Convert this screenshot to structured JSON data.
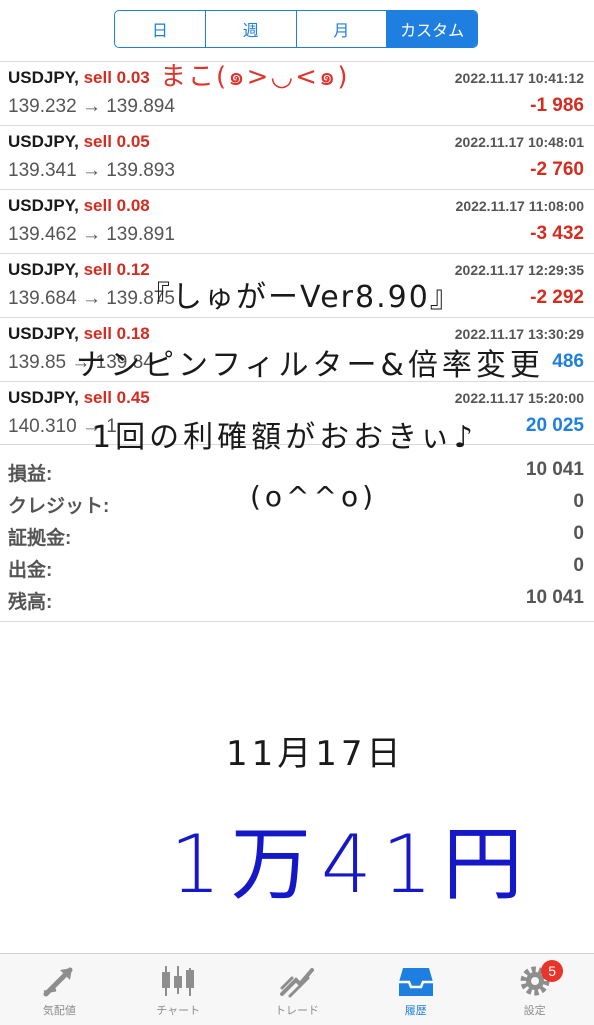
{
  "period_tabs": [
    "日",
    "週",
    "月",
    "カスタム"
  ],
  "period_active": 3,
  "trades": [
    {
      "symbol": "USDJPY",
      "side": "sell 0.03",
      "prices": "139.232 → 139.894",
      "time": "2022.11.17 10:41:12",
      "profit": "-1 986",
      "profit_sign": "neg"
    },
    {
      "symbol": "USDJPY",
      "side": "sell 0.05",
      "prices": "139.341 → 139.893",
      "time": "2022.11.17 10:48:01",
      "profit": "-2 760",
      "profit_sign": "neg"
    },
    {
      "symbol": "USDJPY",
      "side": "sell 0.08",
      "prices": "139.462 → 139.891",
      "time": "2022.11.17 11:08:00",
      "profit": "-3 432",
      "profit_sign": "neg"
    },
    {
      "symbol": "USDJPY",
      "side": "sell 0.12",
      "prices": "139.684 → 139.875",
      "time": "2022.11.17 12:29:35",
      "profit": "-2 292",
      "profit_sign": "neg"
    },
    {
      "symbol": "USDJPY",
      "side": "sell 0.18",
      "prices": "139.85 → 139.84",
      "time": "2022.11.17 13:30:29",
      "profit": "486",
      "profit_sign": "pos"
    },
    {
      "symbol": "USDJPY",
      "side": "sell 0.45",
      "prices": "140.310 → 1",
      "time": "2022.11.17 15:20:00",
      "profit": "20 025",
      "profit_sign": "pos"
    }
  ],
  "summary": [
    {
      "label": "損益:",
      "value": "10 041"
    },
    {
      "label": "クレジット:",
      "value": "0"
    },
    {
      "label": "証拠金:",
      "value": "0"
    },
    {
      "label": "出金:",
      "value": "0"
    },
    {
      "label": "残高:",
      "value": "10 041"
    }
  ],
  "handwriting": {
    "name": "まこ(๑>◡<๑)",
    "line1": "『しゅがーVer8.90』",
    "line2": "ナンピンフィルター&倍率変更",
    "line3": "1回の利確額がおおきぃ♪",
    "line4": "(o^^o)",
    "date": "11月17日",
    "amount": "1万41円"
  },
  "tabbar": {
    "items": [
      {
        "label": "気配値",
        "icon": "quotes-icon"
      },
      {
        "label": "チャート",
        "icon": "chart-icon"
      },
      {
        "label": "トレード",
        "icon": "trade-icon"
      },
      {
        "label": "履歴",
        "icon": "history-icon"
      },
      {
        "label": "設定",
        "icon": "settings-icon"
      }
    ],
    "active": 3,
    "settings_badge": "5"
  },
  "colors": {
    "accent": "#1f7fe0",
    "loss": "#d62b1f",
    "handwriting_blue": "#1418c8",
    "handwriting_red": "#e0332b"
  }
}
